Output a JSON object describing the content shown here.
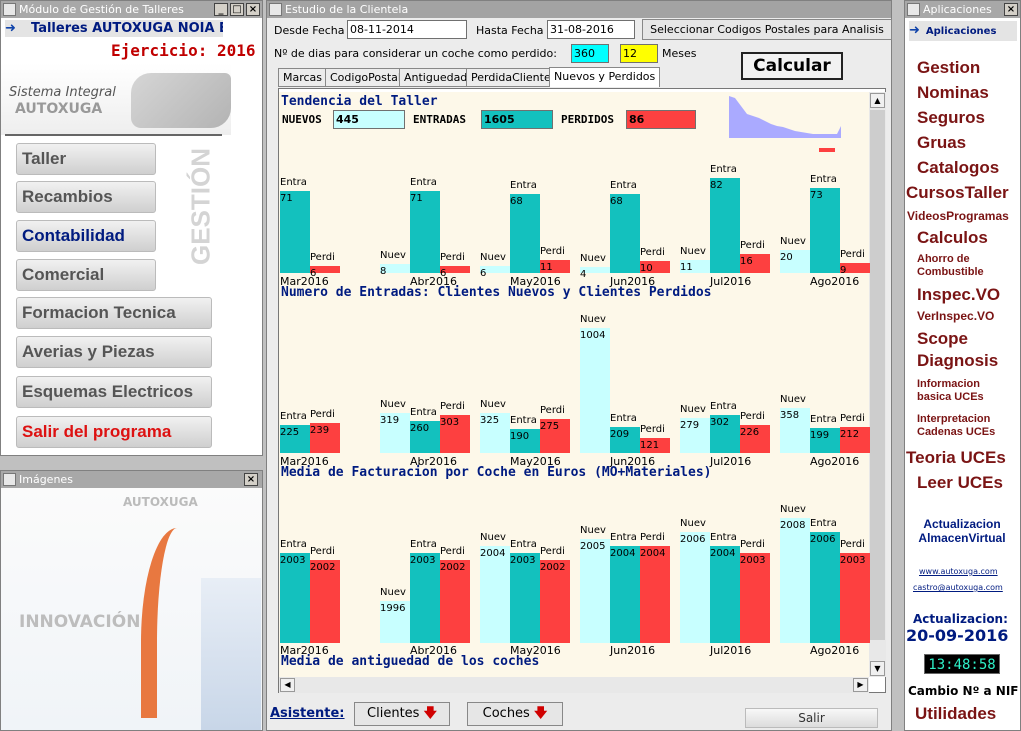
{
  "left_window": {
    "title": "Módulo de Gestión de Talleres",
    "company": "Talleres AUTOXUGA NOIA E",
    "ejercicio": "Ejercicio: 2016",
    "logo_line1": "Sistema Integral",
    "logo_line2": "AUTOXUGA",
    "vertical_label": "GESTIÓN",
    "nav": [
      "Taller",
      "Recambios",
      "Contabilidad",
      "Comercial",
      "Formacion Tecnica",
      "Averias y Piezas",
      "Esquemas Electricos",
      "Salir del programa"
    ]
  },
  "images_window": {
    "title": "Imágenes",
    "brand": "AUTOXUGA",
    "text": "INNOVACIÓN"
  },
  "main_window": {
    "title": "Estudio de la Clientela",
    "desde_label": "Desde Fecha",
    "desde_value": "08-11-2014",
    "hasta_label": "Hasta Fecha",
    "hasta_value": "31-08-2016",
    "cp_button": "Seleccionar Codigos Postales para Analisis",
    "dias_label": "Nº de dias para considerar un coche como perdido:",
    "dias_value": "360",
    "meses_value": "12",
    "meses_label": "Meses",
    "calcular": "Calcular",
    "tabs": [
      "Marcas",
      "CodigoPostal",
      "Antiguedad",
      "PerdidaClientes",
      "Nuevos y Perdidos"
    ],
    "tendencia": "Tendencia del Taller",
    "nuevos_label": "NUEVOS",
    "nuevos_value": "445",
    "entradas_label": "ENTRADAS",
    "entradas_value": "1605",
    "perdidos_label": "PERDIDOS",
    "perdidos_value": "86",
    "section1": "Numero de Entradas: Clientes Nuevos y Clientes Perdidos",
    "section2": "Media de Facturacion por Coche en Euros (MO+Materiales)",
    "section3": "Media de antiguedad de los coches",
    "asistente": "Asistente:",
    "clientes_btn": "Clientes",
    "coches_btn": "Coches",
    "salir_btn": "Salir"
  },
  "right_window": {
    "title": "Aplicaciones",
    "header_btn": "Aplicaciones",
    "links": [
      "Gestion",
      "Nominas",
      "Seguros",
      "Gruas",
      "Catalogos",
      "CursosTaller",
      "VideosProgramas",
      "Calculos",
      "Ahorro de Combustible",
      "Inspec.VO",
      "VerInspec.VO",
      "Scope Diagnosis",
      "Informacion basica UCEs",
      "Interpretacion Cadenas UCEs",
      "Teoria UCEs",
      "Leer UCEs",
      "Actualizacion AlmacenVirtual"
    ],
    "web": "www.autoxuga.com",
    "email": "castro@autoxuga.com",
    "actualizacion_label": "Actualizacion:",
    "actualizacion_date": "20-09-2016",
    "clock": "13:48:58",
    "cambio": "Cambio Nº a NIF",
    "utilidades": "Utilidades"
  },
  "colors": {
    "nuevos": "#c8ffff",
    "entradas": "#13c1be",
    "perdidos": "#fd4040",
    "section": "#001b80",
    "applink": "#7a1414"
  },
  "chart_data": [
    {
      "type": "bar",
      "title": "Numero de Entradas: Clientes Nuevos y Clientes Perdidos",
      "categories": [
        "Mar2016",
        "Abr2016",
        "May2016",
        "Jun2016",
        "Jul2016",
        "Ago2016"
      ],
      "series": [
        {
          "name": "Nuev",
          "values": [
            null,
            8,
            6,
            4,
            11,
            20
          ]
        },
        {
          "name": "Entra",
          "values": [
            71,
            71,
            68,
            68,
            82,
            73
          ]
        },
        {
          "name": "Perdi",
          "values": [
            6,
            6,
            11,
            10,
            16,
            9
          ]
        }
      ]
    },
    {
      "type": "bar",
      "title": "Media de Facturacion por Coche en Euros (MO+Materiales)",
      "categories": [
        "Mar2016",
        "Abr2016",
        "May2016",
        "Jun2016",
        "Jul2016",
        "Ago2016"
      ],
      "series": [
        {
          "name": "Nuev",
          "values": [
            null,
            319,
            325,
            1004,
            279,
            358
          ]
        },
        {
          "name": "Entra",
          "values": [
            225,
            260,
            190,
            209,
            302,
            199
          ]
        },
        {
          "name": "Perdi",
          "values": [
            239,
            303,
            275,
            121,
            226,
            212
          ]
        }
      ]
    },
    {
      "type": "bar",
      "title": "Media de antiguedad de los coches",
      "categories": [
        "Mar2016",
        "Abr2016",
        "May2016",
        "Jun2016",
        "Jul2016",
        "Ago2016"
      ],
      "series": [
        {
          "name": "Nuev",
          "values": [
            null,
            1996,
            2004,
            2005,
            2006,
            2008
          ]
        },
        {
          "name": "Entra",
          "values": [
            2003,
            2003,
            2003,
            2004,
            2004,
            2006
          ]
        },
        {
          "name": "Perdi",
          "values": [
            2002,
            2002,
            2002,
            2004,
            2003,
            2003
          ]
        }
      ]
    }
  ]
}
